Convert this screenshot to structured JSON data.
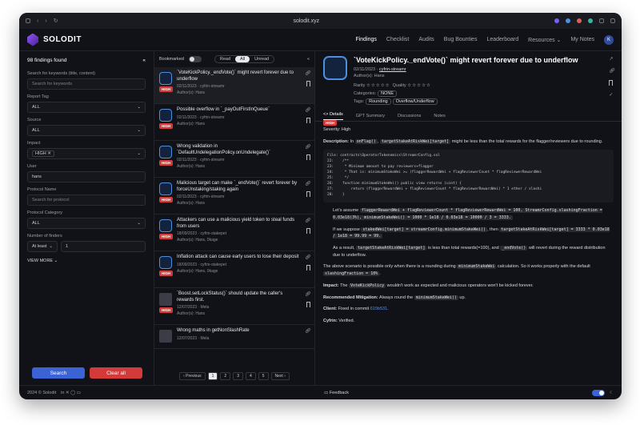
{
  "browser": {
    "url": "solodit.xyz"
  },
  "app": {
    "brand": "SOLODIT"
  },
  "nav": {
    "links": [
      "Findings",
      "Checklist",
      "Audits",
      "Bug Bounties",
      "Leaderboard",
      "Resources ⌄",
      "My Notes"
    ],
    "avatar": "K"
  },
  "filters": {
    "count": "98 findings found",
    "keywords_label": "Search for keywords (title, content)",
    "keywords_placeholder": "Search for keywords",
    "report_tag_label": "Report Tag",
    "report_tag_value": "ALL",
    "source_label": "Source",
    "source_value": "ALL",
    "impact_label": "Impact",
    "impact_chip": "HIGH ✕",
    "user_label": "User",
    "user_value": "hans",
    "protocol_name_label": "Protocol Name",
    "protocol_name_placeholder": "Search for protocol",
    "protocol_category_label": "Protocol Category",
    "protocol_category_value": "ALL",
    "finders_label": "Number of finders",
    "finders_op": "At least",
    "finders_value": "1",
    "view_more": "VIEW MORE ⌄",
    "search_button": "Search",
    "clear_button": "Clear all"
  },
  "list": {
    "bookmarked_label": "Bookmarked",
    "segments": [
      "Read",
      "All",
      "Unread"
    ],
    "items": [
      {
        "title": "`VoteKickPolicy._endVote()` might revert forever due to underflow",
        "date": "02/11/2023 · cyfrin-streamr",
        "authors": "Author(s): Hans",
        "badge": "HIGH"
      },
      {
        "title": "Possible overflow in `_payOutFirstInQueue`",
        "date": "02/11/2023 · cyfrin-streamr",
        "authors": "Author(s): Hans",
        "badge": "HIGH"
      },
      {
        "title": "Wrong validation in `DefaultUndelegationPolicy.onUndelegate()`",
        "date": "02/11/2023 · cyfrin-streamr",
        "authors": "Author(s): Hans",
        "badge": "HIGH"
      },
      {
        "title": "Malicious target can make `_endVote()` revert forever by forceUnstaking/staking again",
        "date": "02/11/2023 · cyfrin-streamr",
        "authors": "Author(s): Hans",
        "badge": "HIGH"
      },
      {
        "title": "Attackers can use a malicious yield token to steal funds from users",
        "date": "18/09/2023 · cyfrin-stakepet",
        "authors": "Author(s): Hans, 0kage",
        "badge": "HIGH"
      },
      {
        "title": "Inflation attack can cause early users to lose their deposit",
        "date": "18/09/2023 · cyfrin-stakepet",
        "authors": "Author(s): Hans, 0kage",
        "badge": "HIGH"
      },
      {
        "title": "`Boost.setLockStatus()` should update the caller's rewards first.",
        "date": "12/07/2023 · Mela",
        "authors": "Author(s): Hans",
        "badge": "HIGH"
      },
      {
        "title": "Wrong maths in getNonSlashRate",
        "date": "12/07/2023 · Mela",
        "authors": "",
        "badge": ""
      }
    ],
    "pager": [
      "‹ Previous",
      "1",
      "2",
      "3",
      "4",
      "5",
      "Next ›"
    ]
  },
  "detail": {
    "title": "`VoteKickPolicy._endVote()` might revert forever due to underflow",
    "date": "02/11/2023 · ",
    "firm": "cyfrin-streamr",
    "authors": "Author(s): Hans",
    "badge": "HIGH",
    "rarity_label": "Rarity",
    "quality_label": "Quality",
    "stars": "☆☆☆☆☆",
    "categories_label": "Categories:",
    "categories_value": "NONE",
    "tags_label": "Tags:",
    "tags": [
      "Rounding",
      "Overflow/Underflow"
    ],
    "tabs": [
      "<> Details",
      "GPT Summary",
      "Discussions",
      "Notes"
    ],
    "severity": "Severity: High",
    "desc_intro": "Description:",
    "desc_a": "In ",
    "desc_code1": "onFlag()",
    "desc_b": ", ",
    "desc_code2": "targetStakeAtRiskWei[target]",
    "desc_c": " might be less than the total rewards for the flagger/reviewers due to rounding.",
    "code": "File: contracts\\OperatorTokenomics\\StreamrConfig.sol\n22:    /**\n23:     * Minimum amount to pay reviewers+flagger\n24:     * That is: minimumStakeWei >= (flaggerRewardWei + flagReviewerCount * flagReviewerRewardWei\n25:     */\n26:    function minimumStakeWei() public view returns (uint) {\n27:        return (flaggerRewardWei + flagReviewerCount * flagReviewerRewardWei) * 1 ether / slashi\n28:    }",
    "l1": "Let's assume ",
    "l1c": "flaggerRewardWei + flagReviewerCount * flagReviewerRewardWei = 100, StreamrConfig.slashingFraction = 0.03e18(3%), minimumStakeWei() = 1000 * 1e18 / 0.03e18 = 10000 / 3 = 3333.",
    "l2": "If we suppose ",
    "l2c": "stakedWei[target] = streamrConfig.minimumStakeWei()",
    "l2b": ", then ",
    "l2c2": "targetStakeAtRiskWei[target] = 3333 * 0.03e18 / 1e18 = 99.99 = 99.",
    "l3": "As a result, ",
    "l3c": "targetStakeAtRiskWei[target]",
    "l3b": " is less than total rewards(=100), and ",
    "l3c2": "_endVote()",
    "l3d": " will revert during the reward distribution due to underflow.",
    "p2a": "The above scenario is possible only when there is a rounding during ",
    "p2c": "minimumStakeWei",
    "p2b": " calculation. So it works properly with the default ",
    "p2c2": "slashingFraction = 10%",
    "p2d": ".",
    "impact_label": "Impact:",
    "impact_a": " The ",
    "impact_code": "VoteKickPolicy",
    "impact_b": " wouldn't work as expected and malicious operators won't be kicked forever.",
    "rec_label": "Recommended Mitigation:",
    "rec_a": " Always round the ",
    "rec_code": "minimumStakeWei()",
    "rec_b": " up.",
    "client_label": "Client:",
    "client_a": " Fixed in commit ",
    "client_link": "615b531",
    "client_b": ".",
    "cyfrin_label": "Cyfrin:",
    "cyfrin_a": " Verified."
  },
  "footer": {
    "copyright": "2024 © Solodit",
    "feedback": "Feedback"
  },
  "colors": {
    "accent": "#3b63d6",
    "danger": "#d33b3b",
    "bg": "#111217"
  }
}
